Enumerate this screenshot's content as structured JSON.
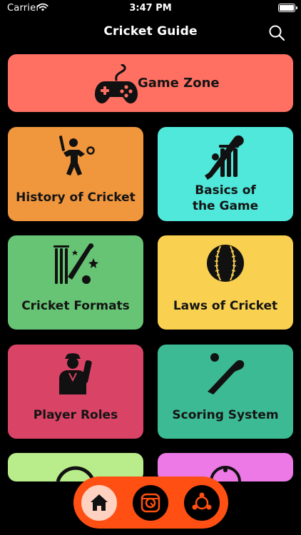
{
  "status_bar": {
    "carrier": "Carrier",
    "time": "3:47 PM"
  },
  "header": {
    "title": "Cricket Guide"
  },
  "game_zone": {
    "label": "Game Zone",
    "color": "#ff7063"
  },
  "tiles": [
    {
      "label": "History of Cricket",
      "color": "#f0963c",
      "icon": "batsman-icon"
    },
    {
      "label_line1": "Basics of",
      "label_line2": "the Game",
      "color": "#4fe8da",
      "icon": "bat-and-stumps-icon"
    },
    {
      "label": "Cricket Formats",
      "color": "#66c474",
      "icon": "trophy-bat-ball-icon"
    },
    {
      "label": "Laws of Cricket",
      "color": "#f9d04f",
      "icon": "cricket-ball-icon"
    },
    {
      "label": "Player Roles",
      "color": "#d94466",
      "icon": "player-icon"
    },
    {
      "label": "Scoring System",
      "color": "#3cba93",
      "icon": "bat-hitting-ball-icon"
    }
  ],
  "partial_tiles": [
    {
      "color": "#b9ec8a"
    },
    {
      "color": "#ec79e6"
    }
  ],
  "tab_bar": {
    "color": "#ff4f12",
    "tabs": [
      {
        "icon": "home-icon",
        "active": true
      },
      {
        "icon": "stadium-icon",
        "active": false
      },
      {
        "icon": "share-network-icon",
        "active": false
      }
    ]
  }
}
